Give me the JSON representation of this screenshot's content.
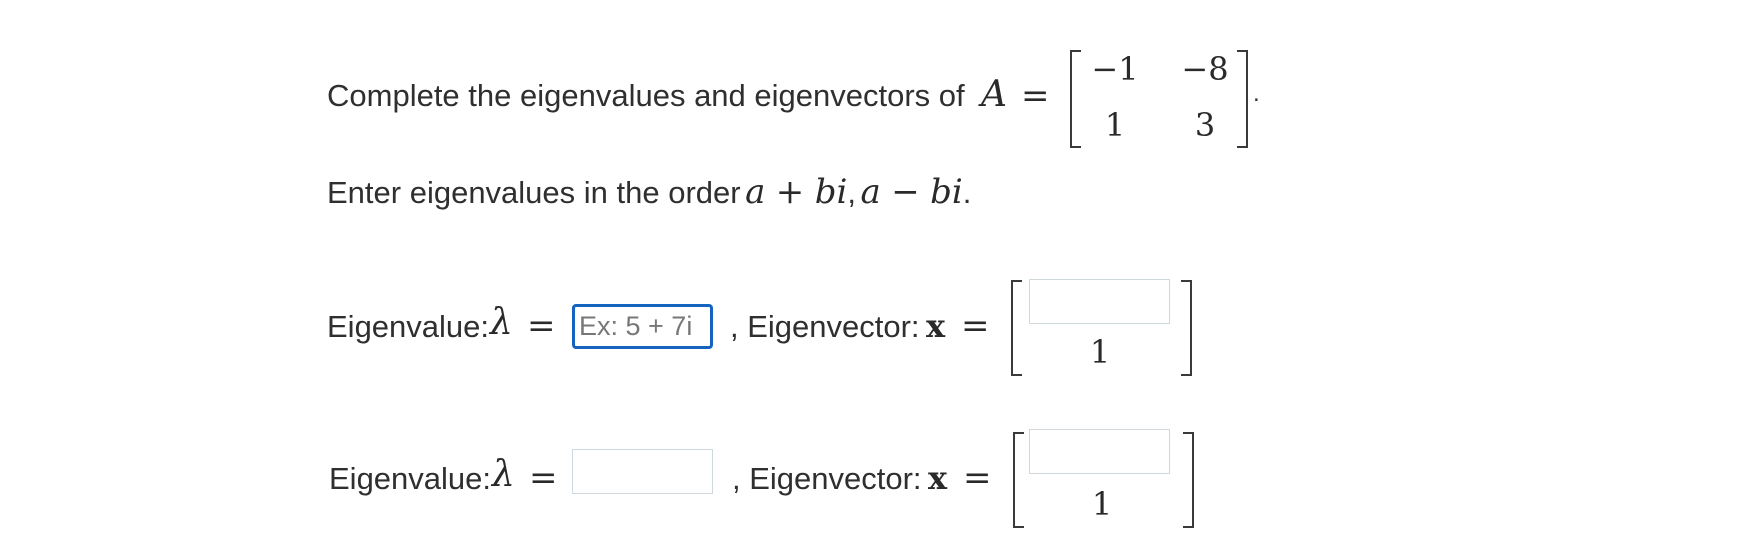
{
  "problem": {
    "prompt": "Complete the eigenvalues and eigenvectors of",
    "matrix_symbol": "A",
    "equals": "=",
    "matrix": [
      [
        "−1",
        "−8"
      ],
      [
        "1",
        "3"
      ]
    ],
    "trailing_period": ".",
    "instruction_prefix": "Enter eigenvalues in the order",
    "instruction_math_a": "a",
    "instruction_math_plus": "+",
    "instruction_math_bi": "bi",
    "instruction_comma": ",",
    "instruction_math_a2": "a",
    "instruction_math_minus": "−",
    "instruction_math_bi2": "bi",
    "instruction_period": "."
  },
  "rows": [
    {
      "eigenvalue_label": "Eigenvalue:",
      "lambda": "λ",
      "equals": "=",
      "eigenvalue_value": "",
      "eigenvalue_placeholder": "Ex: 5 + 7i",
      "eigenvector_label": ", Eigenvector:",
      "x_symbol": "x",
      "equals2": "=",
      "vector_top_value": "",
      "vector_top_placeholder": "",
      "vector_bottom": "1"
    },
    {
      "eigenvalue_label": "Eigenvalue:",
      "lambda": "λ",
      "equals": "=",
      "eigenvalue_value": "",
      "eigenvalue_placeholder": "",
      "eigenvector_label": ", Eigenvector:",
      "x_symbol": "x",
      "equals2": "=",
      "vector_top_value": "",
      "vector_top_placeholder": "",
      "vector_bottom": "1"
    }
  ],
  "colors": {
    "focus_border": "#1565c0",
    "input_border": "#cfd8dc",
    "text": "#2f2f2f"
  }
}
